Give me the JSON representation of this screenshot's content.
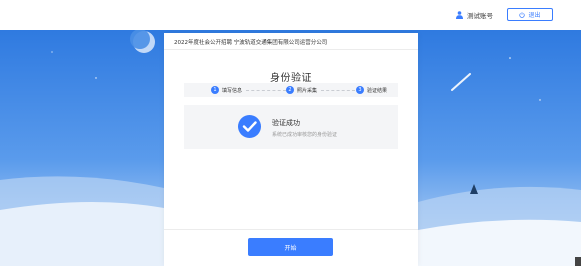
{
  "header": {
    "user_name": "测试账号",
    "logout_label": "退出"
  },
  "panel": {
    "title": "2022年度社会公开招聘 宁波轨道交通集团有限公司运营分公司",
    "page_title": "身份验证",
    "steps": [
      {
        "num": "1",
        "label": "填写信息"
      },
      {
        "num": "2",
        "label": "照片采集"
      },
      {
        "num": "3",
        "label": "验证结果"
      }
    ],
    "result": {
      "title": "验证成功",
      "subtitle": "系统已成功审核您的身份验证"
    },
    "start_label": "开始"
  },
  "colors": {
    "accent": "#3a7dff",
    "background_sky": "#3f86e0"
  }
}
